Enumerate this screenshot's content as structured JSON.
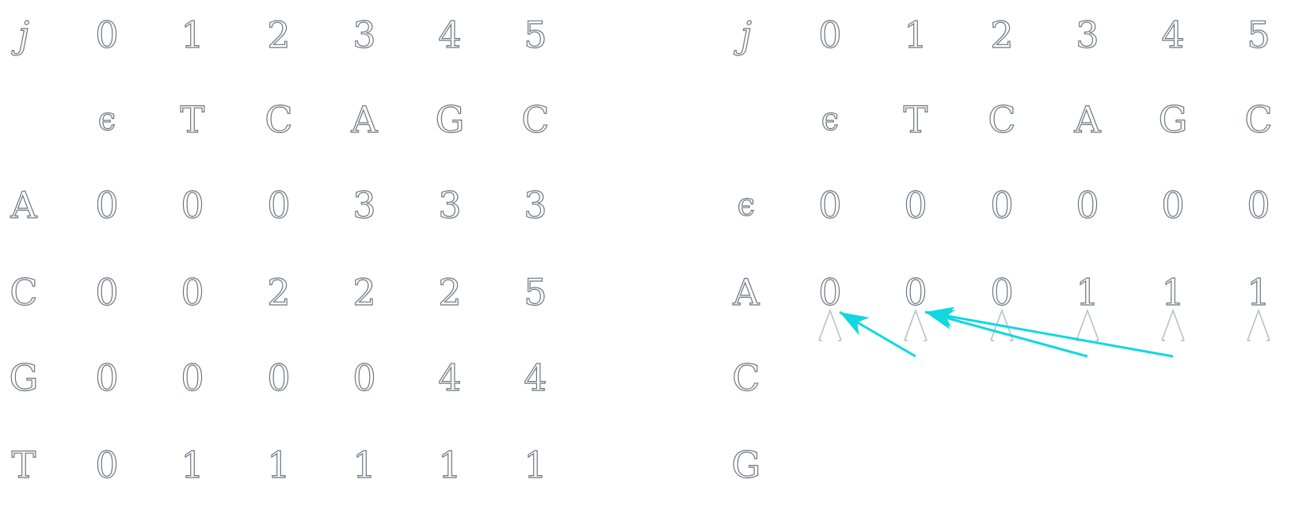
{
  "left_table": {
    "index_label": "j",
    "indices": [
      "0",
      "1",
      "2",
      "3",
      "4",
      "5"
    ],
    "header": [
      "ϵ",
      "T",
      "C",
      "A",
      "G",
      "C"
    ],
    "rows": [
      {
        "label": "A",
        "values": [
          "0",
          "0",
          "0",
          "3",
          "3",
          "3"
        ]
      },
      {
        "label": "C",
        "values": [
          "0",
          "0",
          "2",
          "2",
          "2",
          "5"
        ]
      },
      {
        "label": "G",
        "values": [
          "0",
          "0",
          "0",
          "0",
          "4",
          "4"
        ]
      },
      {
        "label": "T",
        "values": [
          "0",
          "1",
          "1",
          "1",
          "1",
          "1"
        ]
      }
    ]
  },
  "right_table": {
    "index_label": "j",
    "indices": [
      "0",
      "1",
      "2",
      "3",
      "4",
      "5"
    ],
    "header": [
      "ϵ",
      "T",
      "C",
      "A",
      "G",
      "C"
    ],
    "rows": [
      {
        "label": "ϵ",
        "values": [
          "0",
          "0",
          "0",
          "0",
          "0",
          "0"
        ]
      },
      {
        "label": "A",
        "values": [
          "0",
          "0",
          "0",
          "1",
          "1",
          "1"
        ]
      },
      {
        "label": "C",
        "values": []
      },
      {
        "label": "G",
        "values": []
      }
    ],
    "pointer_arrows": [
      {
        "from_col": 1,
        "to_col": 0
      },
      {
        "from_col": 3,
        "to_col": 1
      },
      {
        "from_col": 4,
        "to_col": 1
      }
    ],
    "pointer_marks_row": "A",
    "arrow_color": "#10d8e0",
    "faint_arrow_color": "#b8bcc0"
  },
  "text_color_stroke": "#6b7680"
}
